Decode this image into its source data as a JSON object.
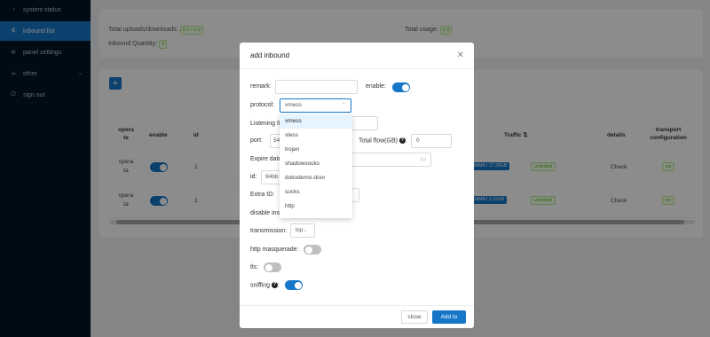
{
  "sidebar": {
    "items": [
      {
        "label": "system status",
        "icon": "dashboard-icon",
        "glyph": "◔"
      },
      {
        "label": "inbound list",
        "icon": "user-icon",
        "glyph": "ዷ"
      },
      {
        "label": "panel settings",
        "icon": "gear-icon",
        "glyph": "✲"
      },
      {
        "label": "other",
        "icon": "link-icon",
        "glyph": "∞"
      },
      {
        "label": "sign out",
        "icon": "logout-icon",
        "glyph": "⏻"
      }
    ],
    "other_chevron": "⌄"
  },
  "stats": {
    "total_label": "Total uploads/downloads:",
    "total_value": "0.0 / 0.0",
    "usage_label": "Total usage:",
    "usage_value": "0.0",
    "quantity_label": "Inbound Quantity:",
    "quantity_value": "0"
  },
  "table": {
    "add_label": "+",
    "headers": {
      "operate": "opera te",
      "enable": "enable",
      "id": "id",
      "traffic": "Traffic ⇅",
      "details": "details",
      "transport": "transport configuration"
    },
    "rows": [
      {
        "operate": "opera ta",
        "id": "1",
        "traffic": "494.98MB / 17.2KGB",
        "limit": "unlimited",
        "details": "Check",
        "transport": "ws"
      },
      {
        "operate": "opera ta",
        "id": "2",
        "traffic": "210.16MB / 1.12GB",
        "limit": "unlimited",
        "details": "Check",
        "transport": "ws"
      }
    ]
  },
  "modal": {
    "title": "add inbound",
    "close_icon": "✕",
    "remark_label": "remark:",
    "remark_value": "",
    "enable_label": "enable:",
    "protocol_label": "protocol:",
    "protocol_value": "vmess",
    "listening_label": "Listening IP",
    "port_label": "port:",
    "port_value": "54",
    "total_flow_label": "Total flow(GB)",
    "total_flow_value": "0",
    "expire_label": "Expire date",
    "id_label": "id:",
    "id_value": "94bb",
    "extra_id_label": "Extra ID:",
    "disable_label": "disable insecure",
    "transmission_label": "transmission:",
    "transmission_value": "tcp",
    "http_label": "http masquerade:",
    "tls_label": "tls:",
    "sniffing_label": "sniffing",
    "close_button": "close",
    "add_button": "Add to"
  },
  "protocol_options": [
    "vmess",
    "vless",
    "trojan",
    "shadowsocks",
    "dokodemo-door",
    "socks",
    "http"
  ],
  "colors": {
    "accent": "#1677c9",
    "sidebar": "#001529",
    "success": "#52c41a"
  }
}
